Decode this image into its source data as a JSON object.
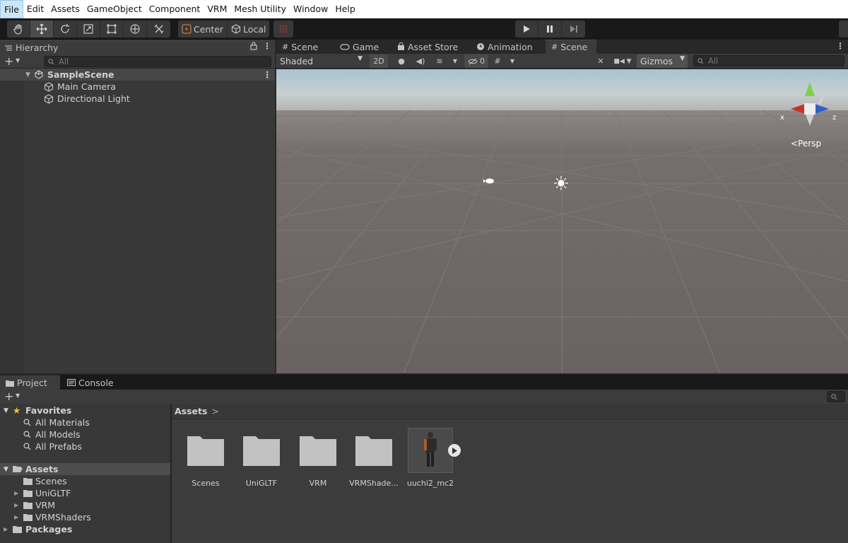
{
  "menu": [
    "File",
    "Edit",
    "Assets",
    "GameObject",
    "Component",
    "VRM",
    "Mesh Utility",
    "Window",
    "Help"
  ],
  "toolbar": {
    "tools": [
      "hand-tool",
      "move-tool",
      "rotate-tool",
      "scale-tool",
      "rect-tool",
      "transform-tool",
      "custom-tool"
    ],
    "active_tool": "move-tool",
    "pivot_label": "Center",
    "space_label": "Local"
  },
  "hierarchy": {
    "tab_label": "Hierarchy",
    "search_placeholder": "All",
    "scene_name": "SampleScene",
    "objects": [
      "Main Camera",
      "Directional Light"
    ]
  },
  "scene": {
    "tabs": [
      "Scene",
      "Game",
      "Asset Store",
      "Animation",
      "Scene"
    ],
    "active_tab_index": 4,
    "shading_mode": "Shaded",
    "mode_2d": "2D",
    "hidden_count": "0",
    "gizmos_label": "Gizmos",
    "search_placeholder": "All",
    "persp_label": "Persp",
    "axis_x": "x",
    "axis_z": "z",
    "colors": {
      "sky_top": "#a9c3d0",
      "horizon": "#b7b7b7",
      "ground": "#6d6563",
      "grid": "#7c7472"
    }
  },
  "project": {
    "tabs": [
      "Project",
      "Console"
    ],
    "favorites_label": "Favorites",
    "favorites": [
      "All Materials",
      "All Models",
      "All Prefabs"
    ],
    "assets_label": "Assets",
    "asset_folders": [
      "Scenes",
      "UniGLTF",
      "VRM",
      "VRMShaders"
    ],
    "packages_label": "Packages",
    "breadcrumb": "Assets",
    "items": [
      {
        "label": "Scenes",
        "kind": "folder"
      },
      {
        "label": "UniGLTF",
        "kind": "folder"
      },
      {
        "label": "VRM",
        "kind": "folder"
      },
      {
        "label": "VRMShade...",
        "kind": "folder"
      },
      {
        "label": "uuchi2_mc2",
        "kind": "model"
      }
    ]
  }
}
